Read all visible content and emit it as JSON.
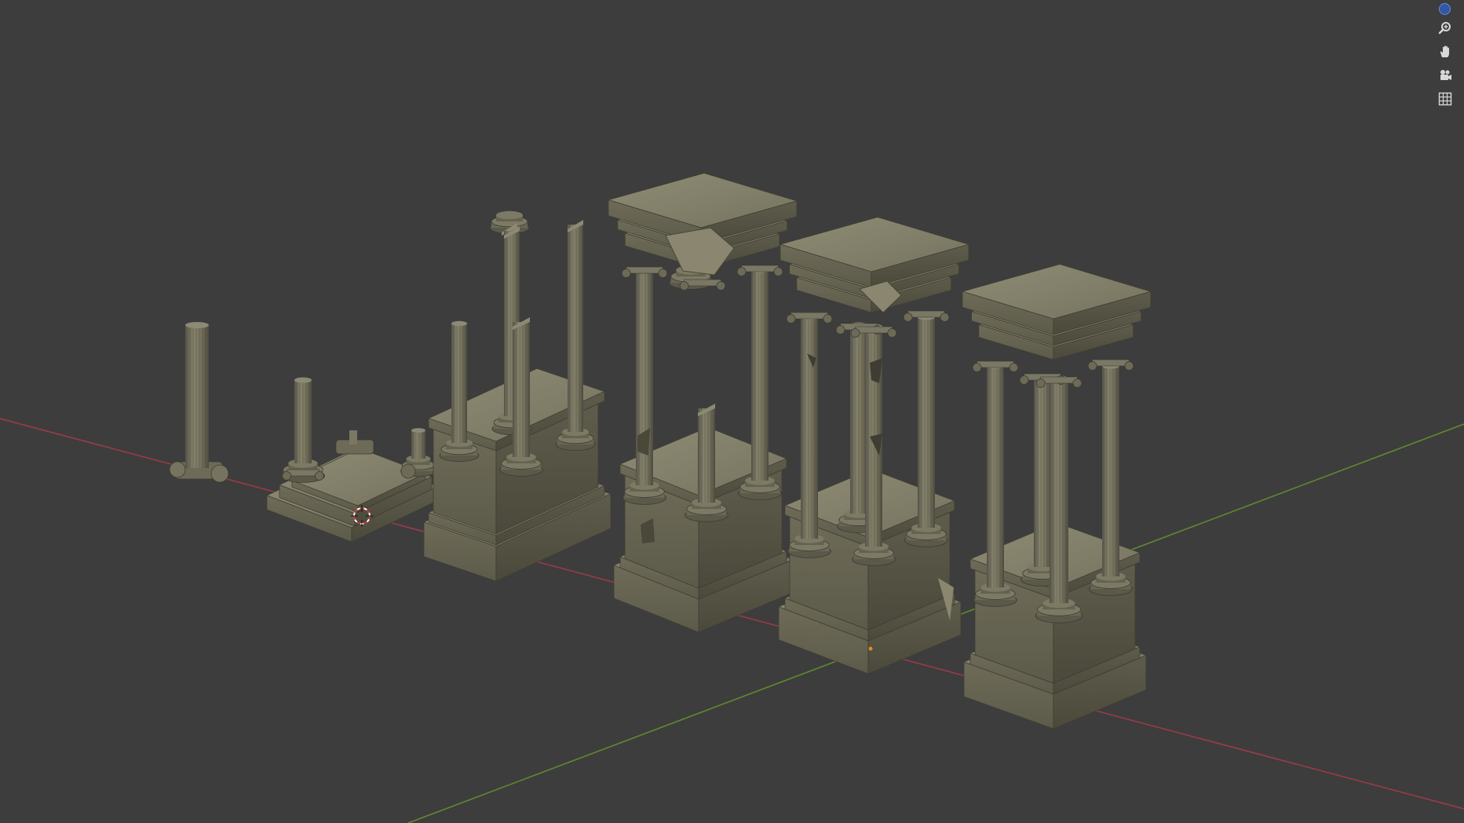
{
  "app": {
    "editor": "3D Viewport"
  },
  "viewport": {
    "background_color": "#3d3d3d",
    "x_axis_color": "#9a3b49",
    "y_axis_color": "#5f8a2c",
    "stone_light": "#8a876f",
    "stone_mid": "#6c6a56",
    "stone_dark": "#4e4c3e"
  },
  "navigation": {
    "axis_gizmo_icon": "axis-z-dot-icon",
    "zoom_icon": "zoom-magnifier-icon",
    "pan_icon": "hand-pan-icon",
    "camera_icon": "camera-view-icon",
    "ortho_icon": "grid-ortho-icon",
    "axis_dot_color": "#3057a8"
  },
  "objects": [
    "single-column",
    "fallen-columns-base",
    "broken-columns-pedestal",
    "ruined-temple-damaged",
    "ruined-temple-cracked",
    "intact-temple"
  ]
}
